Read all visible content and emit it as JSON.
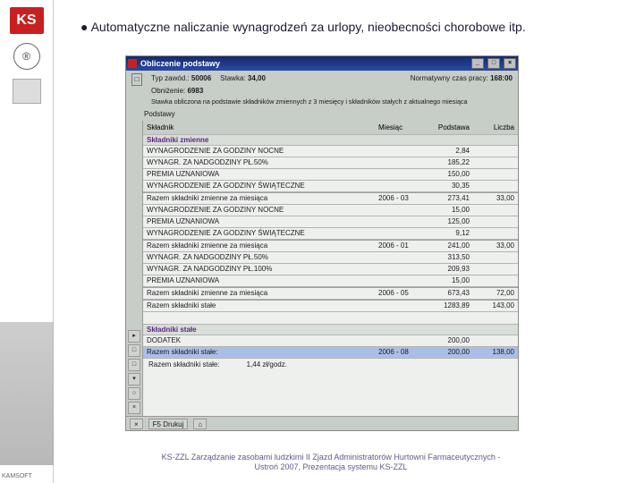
{
  "sidebar": {
    "ks": "KS",
    "r": "®",
    "kamsoft": "KAMSOFT"
  },
  "headline": "● Automatyczne naliczanie wynagrodzeń za urlopy, nieobecności chorobowe itp.",
  "window": {
    "title": "Obliczenie podstawy",
    "top": {
      "line1a": "Typ zawód.:",
      "line1av": "50006",
      "line1b": "Stawka:",
      "line1bv": "34,00",
      "line1c": "Normatywny czas pracy:",
      "line1cv": "168:00",
      "line2a": "Obniżenie:",
      "line2av": "6983",
      "line3": "Stawka obliczona na podstawie składników zmiennych z 3 miesięcy i składników stałych z aktualnego miesiąca",
      "sub": "Podstawy"
    },
    "columns": {
      "c1": "Składnik",
      "c2": "Miesiąc",
      "c3": "Podstawa",
      "c4": "Liczba"
    },
    "sections": {
      "zmienne": "Składniki zmienne",
      "stale": "Składniki stałe"
    },
    "rows": [
      {
        "c1": "WYNAGRODZENIE ZA GODZINY NOCNE",
        "c2": "",
        "c3": "2,84",
        "c4": ""
      },
      {
        "c1": "WYNAGR. ZA NADGODZINY PŁ.50%",
        "c2": "",
        "c3": "185,22",
        "c4": ""
      },
      {
        "c1": "PREMIA UZNANIOWA",
        "c2": "",
        "c3": "150,00",
        "c4": ""
      },
      {
        "c1": "WYNAGRODZENIE ZA GODZINY ŚWIĄTECZNE",
        "c2": "",
        "c3": "30,35",
        "c4": ""
      },
      {
        "sum": true,
        "c1": "Razem składniki zmienne za miesiąca",
        "c2": "2006 - 03",
        "c3": "273,41",
        "c4": "33,00"
      },
      {
        "c1": "WYNAGRODZENIE ZA GODZINY NOCNE",
        "c2": "",
        "c3": "15,00",
        "c4": ""
      },
      {
        "c1": "PREMIA UZNANIOWA",
        "c2": "",
        "c3": "125,00",
        "c4": ""
      },
      {
        "c1": "WYNAGRODZENIE ZA GODZINY ŚWIĄTECZNE",
        "c2": "",
        "c3": "9,12",
        "c4": ""
      },
      {
        "sum": true,
        "c1": "Razem składniki zmienne za miesiąca",
        "c2": "2006 - 01",
        "c3": "241,00",
        "c4": "33,00"
      },
      {
        "c1": "WYNAGR. ZA NADGODZINY PŁ.50%",
        "c2": "",
        "c3": "313,50",
        "c4": ""
      },
      {
        "c1": "WYNAGR. ZA NADGODZINY PŁ.100%",
        "c2": "",
        "c3": "209,93",
        "c4": ""
      },
      {
        "c1": "PREMIA UZNANIOWA",
        "c2": "",
        "c3": "15,00",
        "c4": ""
      },
      {
        "sum": true,
        "c1": "Razem składniki zmienne za miesiąca",
        "c2": "2006 - 05",
        "c3": "673,43",
        "c4": "72,00"
      },
      {
        "sum": true,
        "c1": "Razem składniki stałe",
        "c2": "",
        "c3": "1283,89",
        "c4": "143,00"
      }
    ],
    "stale_rows": [
      {
        "c1": "DODATEK",
        "c2": "",
        "c3": "200,00",
        "c4": ""
      },
      {
        "c1": "Razem składniki stałe:",
        "c2": "2006 - 08",
        "c3": "200,00",
        "c4": "138,00",
        "hl": true
      }
    ],
    "rate": "1,44 zł/godz.",
    "status": {
      "f5": "F5 Drukuj"
    }
  },
  "footer": {
    "l1": "KS-ZZL Zarządzanie zasobami ludzkimi II Zjazd Administratorów Hurtowni Farmaceutycznych -",
    "l2": "Ustroń 2007, Prezentacja systemu KS-ZZL"
  }
}
